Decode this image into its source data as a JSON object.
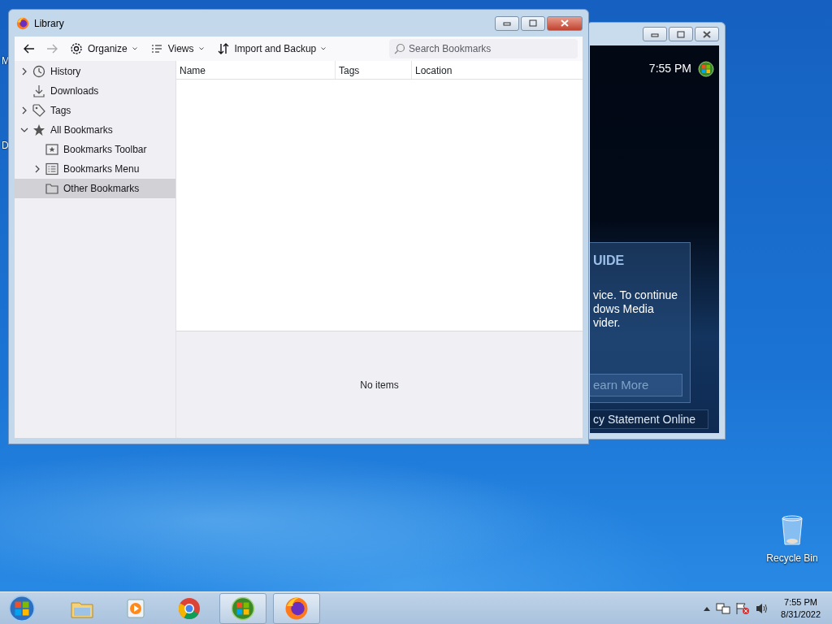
{
  "desktop": {
    "partial_labels": [
      "M",
      "D"
    ],
    "icons": [
      {
        "label": "Recycle Bin",
        "kind": "recycle-bin"
      }
    ]
  },
  "background_window": {
    "clock": "7:55 PM",
    "panel": {
      "heading": "UIDE",
      "lines": [
        "vice. To continue",
        "dows Media",
        "vider."
      ],
      "button": "earn More",
      "link": "cy Statement Online"
    }
  },
  "window": {
    "title": "Library",
    "toolbar": {
      "back": {
        "disabled": false
      },
      "forward": {
        "disabled": true
      },
      "menus": [
        {
          "label": "Organize",
          "kind": "gear"
        },
        {
          "label": "Views",
          "kind": "list"
        },
        {
          "label": "Import and Backup",
          "kind": "sort"
        }
      ],
      "search": {
        "placeholder": "Search Bookmarks"
      }
    },
    "sidebar": {
      "items": [
        {
          "label": "History",
          "kind": "clock",
          "expanded": false,
          "selected": false
        },
        {
          "label": "Downloads",
          "kind": "download",
          "selected": false
        },
        {
          "label": "Tags",
          "kind": "tag",
          "expanded": false,
          "selected": false
        },
        {
          "label": "All Bookmarks",
          "kind": "star",
          "expanded": true,
          "selected": false,
          "children": [
            {
              "label": "Bookmarks Toolbar",
              "kind": "toolbar",
              "selected": false
            },
            {
              "label": "Bookmarks Menu",
              "kind": "menu",
              "expanded": false,
              "selected": false
            },
            {
              "label": "Other Bookmarks",
              "kind": "folder",
              "selected": true
            }
          ]
        }
      ]
    },
    "table": {
      "columns": [
        "Name",
        "Tags",
        "Location"
      ]
    },
    "details": {
      "message": "No items"
    }
  },
  "taskbar": {
    "apps": [
      {
        "kind": "explorer",
        "active": false
      },
      {
        "kind": "media",
        "active": false
      },
      {
        "kind": "chrome",
        "active": false
      },
      {
        "kind": "wmp",
        "active": true
      },
      {
        "kind": "firefox",
        "active": true
      }
    ],
    "clock": {
      "time": "7:55 PM",
      "date": "8/31/2022"
    }
  }
}
